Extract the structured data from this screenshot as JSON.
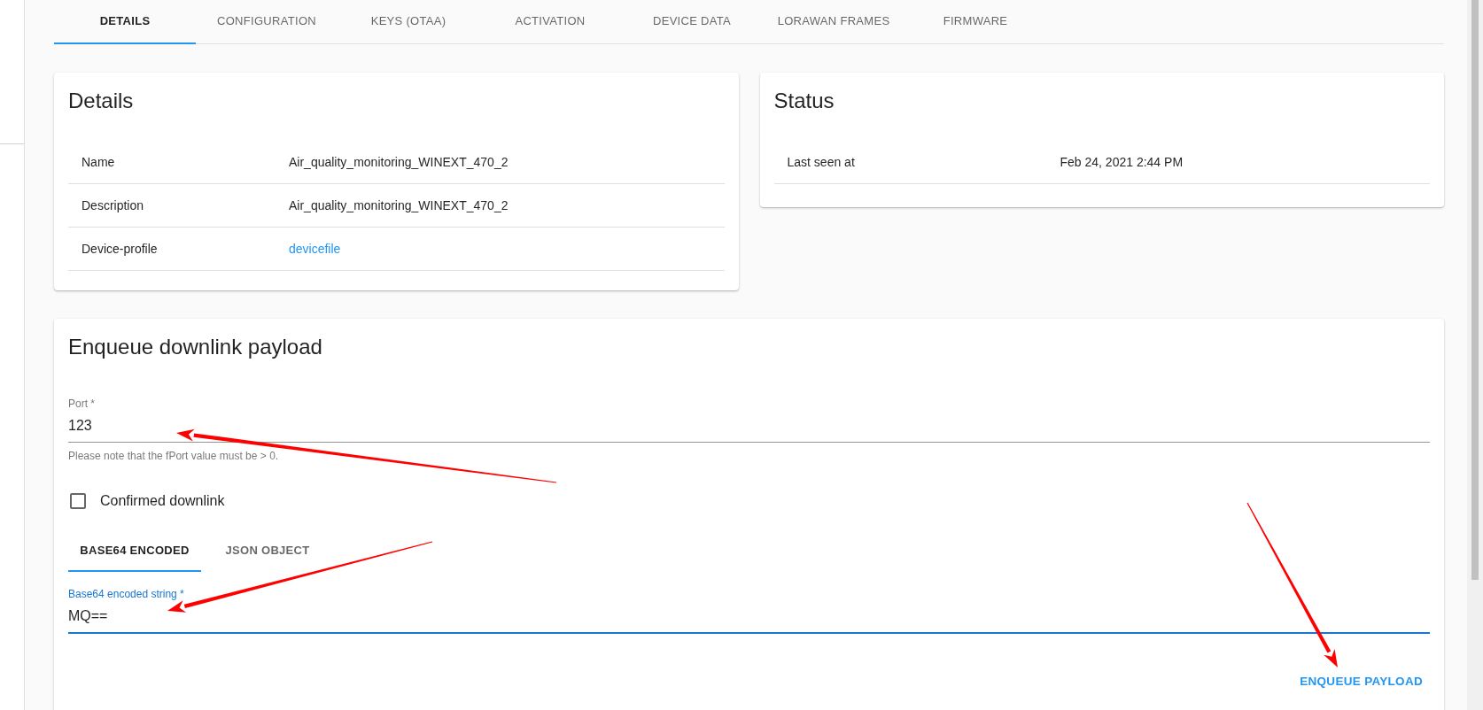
{
  "tabs": [
    {
      "label": "DETAILS",
      "selected": true
    },
    {
      "label": "CONFIGURATION",
      "selected": false
    },
    {
      "label": "KEYS (OTAA)",
      "selected": false
    },
    {
      "label": "ACTIVATION",
      "selected": false
    },
    {
      "label": "DEVICE DATA",
      "selected": false
    },
    {
      "label": "LORAWAN FRAMES",
      "selected": false
    },
    {
      "label": "FIRMWARE",
      "selected": false
    }
  ],
  "details_card": {
    "title": "Details",
    "rows": [
      {
        "label": "Name",
        "value": "Air_quality_monitoring_WINEXT_470_2",
        "kind": "text"
      },
      {
        "label": "Description",
        "value": "Air_quality_monitoring_WINEXT_470_2",
        "kind": "text"
      },
      {
        "label": "Device-profile",
        "value": "devicefile",
        "kind": "link"
      }
    ]
  },
  "status_card": {
    "title": "Status",
    "rows": [
      {
        "label": "Last seen at",
        "value": "Feb 24, 2021 2:44 PM",
        "kind": "text"
      }
    ]
  },
  "enqueue_card": {
    "title": "Enqueue downlink payload",
    "port_field": {
      "label": "Port *",
      "value": "123",
      "helper": "Please note that the fPort value must be > 0.",
      "focused": false
    },
    "confirmed_checkbox": {
      "label": "Confirmed downlink",
      "checked": false
    },
    "payload_tabs": [
      {
        "label": "BASE64 ENCODED",
        "selected": true
      },
      {
        "label": "JSON OBJECT",
        "selected": false
      }
    ],
    "payload_field": {
      "label": "Base64 encoded string *",
      "value": "MQ==",
      "focused": true
    },
    "button": "ENQUEUE PAYLOAD"
  }
}
